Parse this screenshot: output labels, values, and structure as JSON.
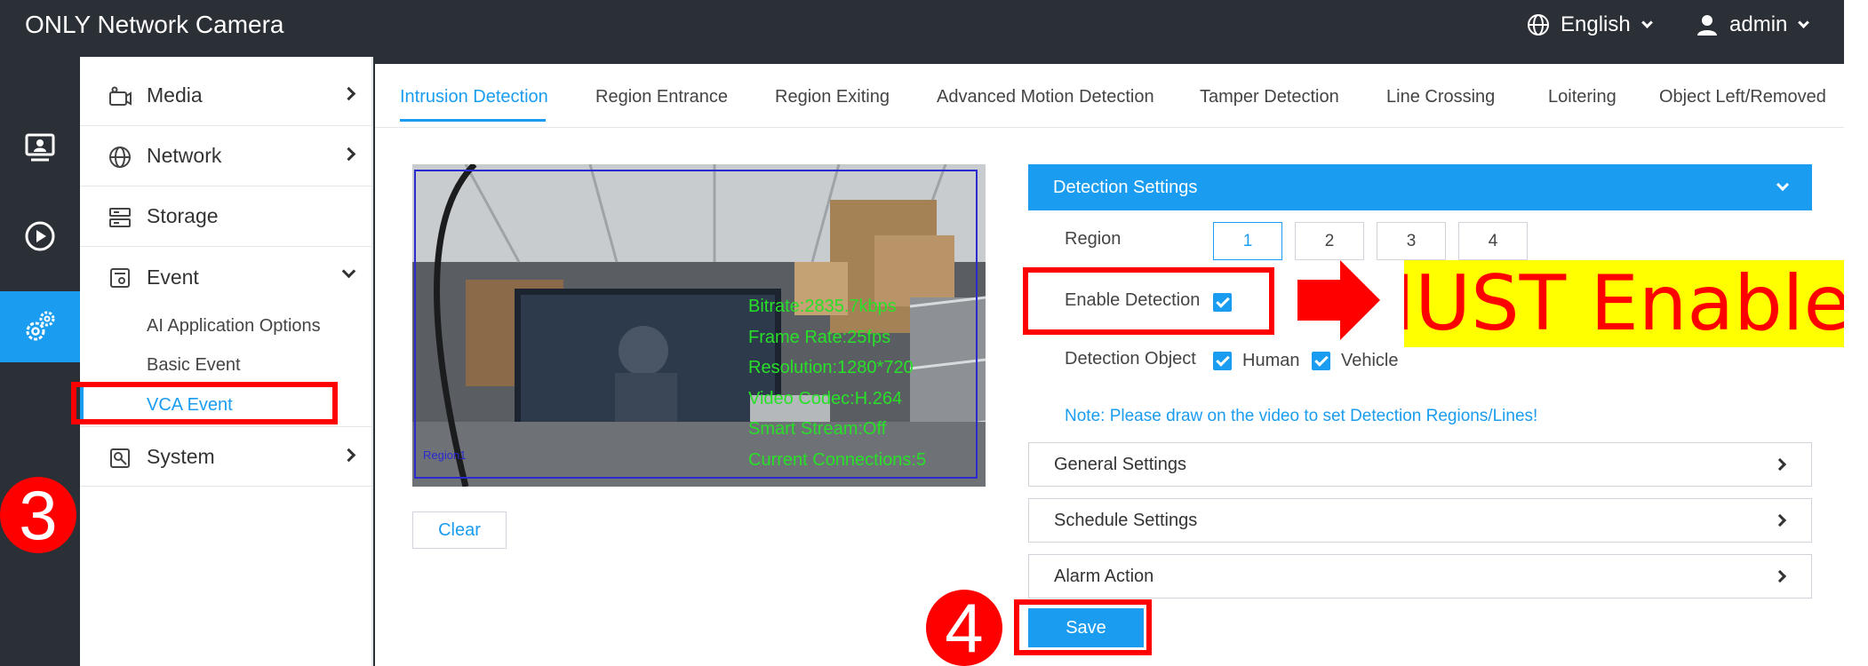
{
  "header": {
    "title": "ONLY Network Camera",
    "language": "English",
    "user": "admin"
  },
  "rail": [
    "live-view",
    "playback",
    "settings"
  ],
  "menu": {
    "media": "Media",
    "network": "Network",
    "storage": "Storage",
    "event": "Event",
    "event_items": [
      "AI Application Options",
      "Basic Event",
      "VCA Event"
    ],
    "system": "System"
  },
  "tabs": [
    "Intrusion Detection",
    "Region Entrance",
    "Region Exiting",
    "Advanced Motion Detection",
    "Tamper Detection",
    "Line Crossing",
    "Loitering",
    "Object Left/Removed"
  ],
  "video": {
    "overlay": [
      "Bitrate:2835.7kbps",
      "Frame Rate:25fps",
      "Resolution:1280*720",
      "Video Codec:H.264",
      "Smart Stream:Off",
      "Current Connections:5"
    ],
    "region_label": "Region1"
  },
  "clear_label": "Clear",
  "detection": {
    "header": "Detection Settings",
    "region_label": "Region",
    "regions": [
      "1",
      "2",
      "3",
      "4"
    ],
    "enable_label": "Enable Detection",
    "object_label": "Detection Object",
    "human": "Human",
    "vehicle": "Vehicle",
    "note": "Note: Please draw on the video to set Detection Regions/Lines!"
  },
  "accordions": [
    "General Settings",
    "Schedule Settings",
    "Alarm Action"
  ],
  "save_label": "Save",
  "annotations": {
    "step3": "3",
    "step4": "4",
    "must": "MUST Enabled"
  },
  "colors": {
    "accent": "#1a9cf0",
    "dark": "#2b2f36",
    "annotation": "#ff0000",
    "highlight": "#ffff00"
  }
}
